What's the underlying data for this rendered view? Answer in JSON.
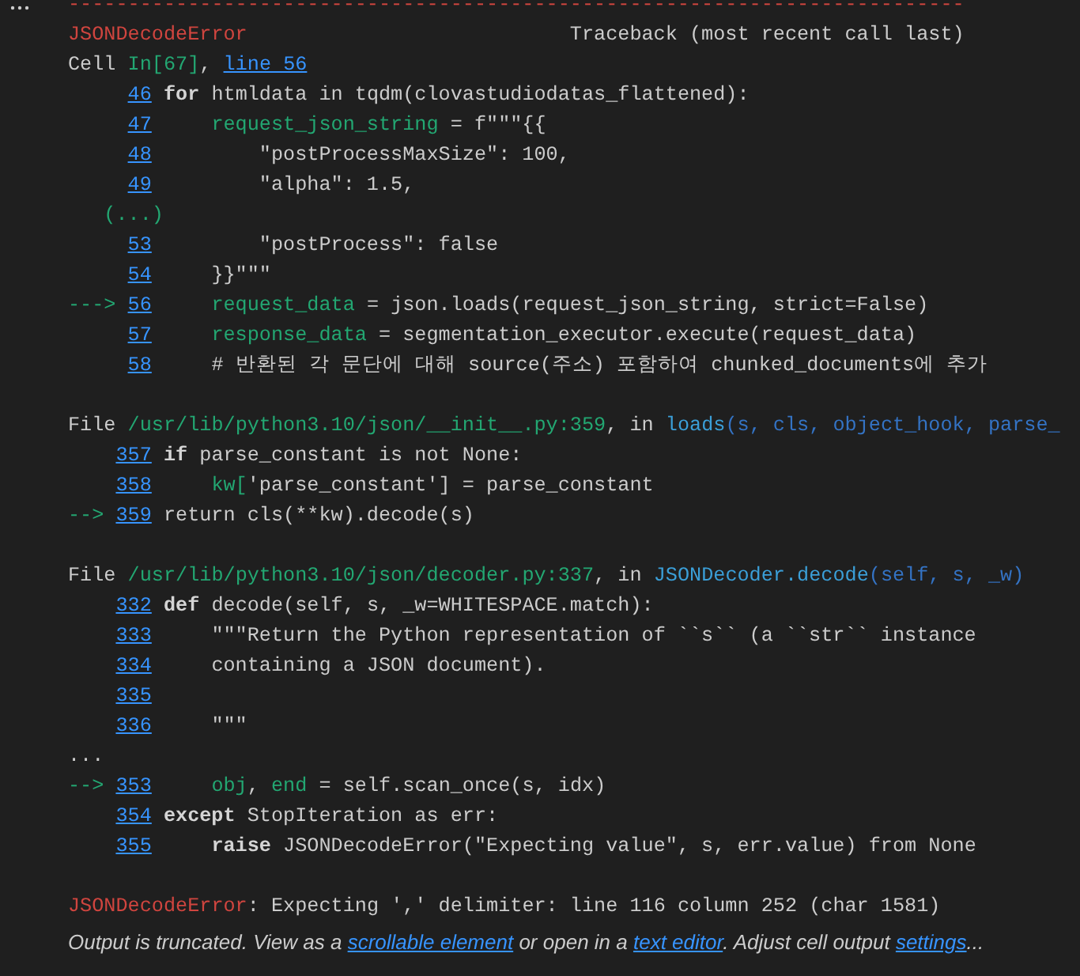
{
  "separator": "---------------------------------------------------------------------------",
  "error_header": [
    {
      "text": "JSONDecodeError",
      "kind": "error_name"
    },
    {
      "text": "Traceback (most recent call last)",
      "kind": "traceback_label"
    }
  ],
  "frames": [
    {
      "header": [
        {
          "text": "Cell ",
          "kind": "text"
        },
        {
          "text": "In[67]",
          "kind": "cell_ref"
        },
        {
          "text": ", ",
          "kind": "text"
        },
        {
          "text": "line 56",
          "kind": "link"
        }
      ],
      "lines": [
        {
          "kind": "code",
          "number": "46",
          "indented": false,
          "code": [
            {
              "text": "for",
              "kind": "keyword"
            },
            {
              "text": " htmldata in tqdm(clovastudiodatas_flattened):",
              "kind": "text"
            }
          ]
        },
        {
          "kind": "code",
          "number": "47",
          "indented": true,
          "code": [
            {
              "text": "request_json_string",
              "kind": "variable"
            },
            {
              "text": " = f\"\"\"{{",
              "kind": "text"
            }
          ]
        },
        {
          "kind": "code",
          "number": "48",
          "indented": true,
          "code": [
            {
              "text": "    \"postProcessMaxSize\": 100,",
              "kind": "text"
            }
          ]
        },
        {
          "kind": "code",
          "number": "49",
          "indented": true,
          "code": [
            {
              "text": "    \"alpha\": 1.5,",
              "kind": "text"
            }
          ]
        },
        {
          "kind": "omitted",
          "text": "(...)"
        },
        {
          "kind": "code",
          "number": "53",
          "indented": true,
          "code": [
            {
              "text": "    \"postProcess\": false",
              "kind": "text"
            }
          ]
        },
        {
          "kind": "code",
          "number": "54",
          "indented": true,
          "code": [
            {
              "text": "}}\"\"\"",
              "kind": "text"
            }
          ]
        },
        {
          "kind": "code",
          "number": "56",
          "arrow": "--->",
          "indented": true,
          "code": [
            {
              "text": "request_data",
              "kind": "variable"
            },
            {
              "text": " = json.loads(request_json_string, strict=False)",
              "kind": "text"
            }
          ]
        },
        {
          "kind": "code",
          "number": "57",
          "indented": true,
          "code": [
            {
              "text": "response_data",
              "kind": "variable"
            },
            {
              "text": " = segmentation_executor.execute(request_data)",
              "kind": "text"
            }
          ]
        },
        {
          "kind": "code",
          "number": "58",
          "indented": true,
          "code": [
            {
              "text": "# 반환된 각 문단에 대해 source(주소) 포함하여 chunked_documents에 추가",
              "kind": "text"
            }
          ]
        }
      ]
    },
    {
      "header": [
        {
          "text": "File ",
          "kind": "text"
        },
        {
          "text": "/usr/lib/python3.10/json/__init__.py:359",
          "kind": "path"
        },
        {
          "text": ", in ",
          "kind": "text"
        },
        {
          "text": "loads",
          "kind": "function"
        },
        {
          "text": "(s, cls, object_hook, parse_",
          "kind": "arguments"
        }
      ],
      "lines": [
        {
          "kind": "code",
          "number": "357",
          "indented": false,
          "code": [
            {
              "text": "if",
              "kind": "keyword"
            },
            {
              "text": " parse_constant is not None:",
              "kind": "text"
            }
          ]
        },
        {
          "kind": "code",
          "number": "358",
          "indented": true,
          "code": [
            {
              "text": "kw[",
              "kind": "variable"
            },
            {
              "text": "'parse_constant'] = parse_constant",
              "kind": "text"
            }
          ]
        },
        {
          "kind": "code",
          "number": "359",
          "arrow": "-->",
          "indented": false,
          "code": [
            {
              "text": "return cls(**kw).decode(s)",
              "kind": "text"
            }
          ]
        }
      ]
    },
    {
      "header": [
        {
          "text": "File ",
          "kind": "text"
        },
        {
          "text": "/usr/lib/python3.10/json/decoder.py:337",
          "kind": "path"
        },
        {
          "text": ", in ",
          "kind": "text"
        },
        {
          "text": "JSONDecoder.decode",
          "kind": "function"
        },
        {
          "text": "(self, s, _w)",
          "kind": "arguments"
        }
      ],
      "lines": [
        {
          "kind": "code",
          "number": "332",
          "indented": false,
          "code": [
            {
              "text": "def",
              "kind": "keyword"
            },
            {
              "text": " decode(self, s, _w=WHITESPACE.match):",
              "kind": "text"
            }
          ]
        },
        {
          "kind": "code",
          "number": "333",
          "indented": true,
          "code": [
            {
              "text": "\"\"\"Return the Python representation of ``s`` (a ``str`` instance",
              "kind": "text"
            }
          ]
        },
        {
          "kind": "code",
          "number": "334",
          "indented": true,
          "code": [
            {
              "text": "containing a JSON document).",
              "kind": "text"
            }
          ]
        },
        {
          "kind": "code",
          "number": "335"
        },
        {
          "kind": "code",
          "number": "336",
          "indented": true,
          "code": [
            {
              "text": "\"\"\"",
              "kind": "text"
            }
          ]
        },
        {
          "kind": "skip",
          "text": "..."
        },
        {
          "kind": "code",
          "number": "353",
          "arrow": "-->",
          "indented": true,
          "code": [
            {
              "text": "obj",
              "kind": "variable"
            },
            {
              "text": ", ",
              "kind": "text"
            },
            {
              "text": "end",
              "kind": "variable"
            },
            {
              "text": " = self.scan_once(s, idx)",
              "kind": "text"
            }
          ]
        },
        {
          "kind": "code",
          "number": "354",
          "indented": false,
          "code": [
            {
              "text": "except",
              "kind": "keyword"
            },
            {
              "text": " StopIteration as err:",
              "kind": "text"
            }
          ]
        },
        {
          "kind": "code",
          "number": "355",
          "indented": true,
          "code": [
            {
              "text": "raise",
              "kind": "keyword"
            },
            {
              "text": " JSONDecodeError(\"Expecting value\", s, err.value) from None",
              "kind": "text"
            }
          ]
        }
      ]
    }
  ],
  "final_error": [
    {
      "text": "JSONDecodeError",
      "kind": "error_name"
    },
    {
      "text": ": Expecting ',' delimiter: line 116 column 252 (char 1581)",
      "kind": "text"
    }
  ],
  "notice": [
    {
      "text": "Output is truncated. View as a ",
      "kind": "text"
    },
    {
      "text": "scrollable element",
      "kind": "link"
    },
    {
      "text": " or open in a ",
      "kind": "text"
    },
    {
      "text": "text editor",
      "kind": "link"
    },
    {
      "text": ". Adjust cell output ",
      "kind": "text"
    },
    {
      "text": "settings",
      "kind": "link"
    },
    {
      "text": "...",
      "kind": "text"
    }
  ]
}
